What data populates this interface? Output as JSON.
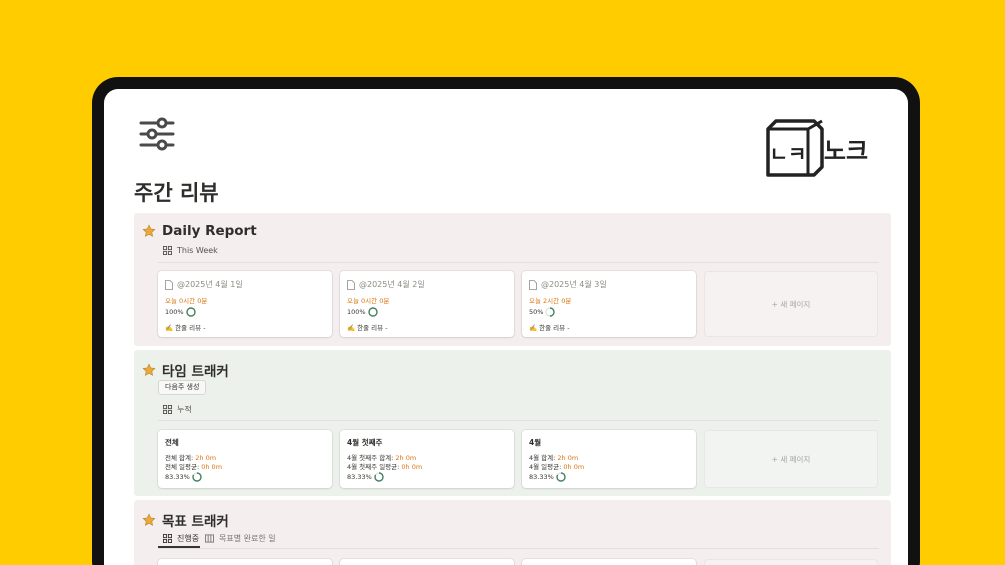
{
  "page": {
    "title": "주간 리뷰",
    "page_icon": "sliders-icon",
    "logo_text": "노크",
    "logo_box_text": "ㄴㅋ"
  },
  "colors": {
    "background": "#FFCC00",
    "section_red": "#F4EEEE",
    "section_green": "#EDF1EC",
    "accent_orange": "#D9730D",
    "ring_green": "#448361"
  },
  "sections": [
    {
      "title": "Daily Report",
      "icon": "star-icon",
      "view_label": "This Week",
      "new_page_label": "+ 새 페이지",
      "cards": [
        {
          "title": "@2025년 4월 1일",
          "time": "오늘 0시간 0분",
          "progress": "100%",
          "progress_value": 1.0,
          "review": "✍️ 한줄 리뷰 -"
        },
        {
          "title": "@2025년 4월 2일",
          "time": "오늘 0시간 0분",
          "progress": "100%",
          "progress_value": 1.0,
          "review": "✍️ 한줄 리뷰 -"
        },
        {
          "title": "@2025년 4월 3일",
          "time": "오늘 2시간 0분",
          "progress": "50%",
          "progress_value": 0.5,
          "review": "✍️ 한줄 리뷰 -"
        }
      ]
    },
    {
      "title": "타임 트래커",
      "icon": "star-icon",
      "button_label": "다음주 생성",
      "view_label": "누적",
      "new_page_label": "+ 새 페이지",
      "cards": [
        {
          "title": "전체",
          "line1_label": "전체 합계: ",
          "line1_value": "2h 0m",
          "line2_label": "전체 일평균: ",
          "line2_value": "0h 0m",
          "progress": "83.33%",
          "progress_value": 0.8333
        },
        {
          "title": "4월 첫째주",
          "line1_label": "4월 첫째주 합계: ",
          "line1_value": "2h 0m",
          "line2_label": "4월 첫째주 일평균: ",
          "line2_value": "0h 0m",
          "progress": "83.33%",
          "progress_value": 0.8333
        },
        {
          "title": "4월",
          "line1_label": "4월 합계: ",
          "line1_value": "2h 0m",
          "line2_label": "4월 일평균: ",
          "line2_value": "0h 0m",
          "progress": "83.33%",
          "progress_value": 0.8333
        }
      ]
    },
    {
      "title": "목표 트래커",
      "icon": "star-icon",
      "tabs": [
        {
          "label": "진행중",
          "icon": "gallery-icon",
          "active": true
        },
        {
          "label": "목표별 완료한 일",
          "icon": "board-icon",
          "active": false
        }
      ]
    }
  ]
}
